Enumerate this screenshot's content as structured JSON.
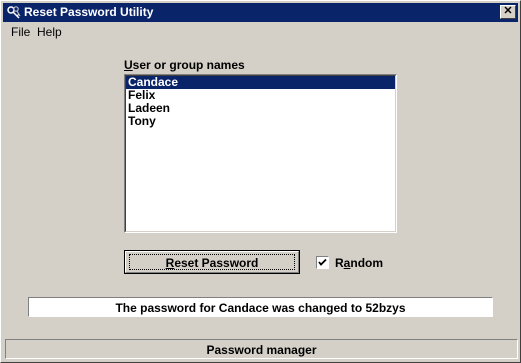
{
  "window": {
    "title": "Reset Password Utility",
    "close_glyph": "✕",
    "icon": "keys-icon"
  },
  "menu": {
    "items": [
      {
        "label": "File"
      },
      {
        "label": "Help"
      }
    ]
  },
  "users": {
    "label_prefix": "U",
    "label_rest": "ser or group names",
    "items": [
      {
        "label": "Candace",
        "selected": true
      },
      {
        "label": "Felix",
        "selected": false
      },
      {
        "label": "Ladeen",
        "selected": false
      },
      {
        "label": "Tony",
        "selected": false
      }
    ]
  },
  "actions": {
    "reset_prefix": "R",
    "reset_rest": "eset Password",
    "random_prefix": "R",
    "random_mid": "a",
    "random_rest": "ndom",
    "random_checked": true
  },
  "status": {
    "message": "The password for Candace was changed to 52bzys",
    "footer": "Password manager"
  },
  "colors": {
    "face": "#d4d0c8",
    "title_bar": "#0a246a",
    "selection": "#0a246a"
  }
}
